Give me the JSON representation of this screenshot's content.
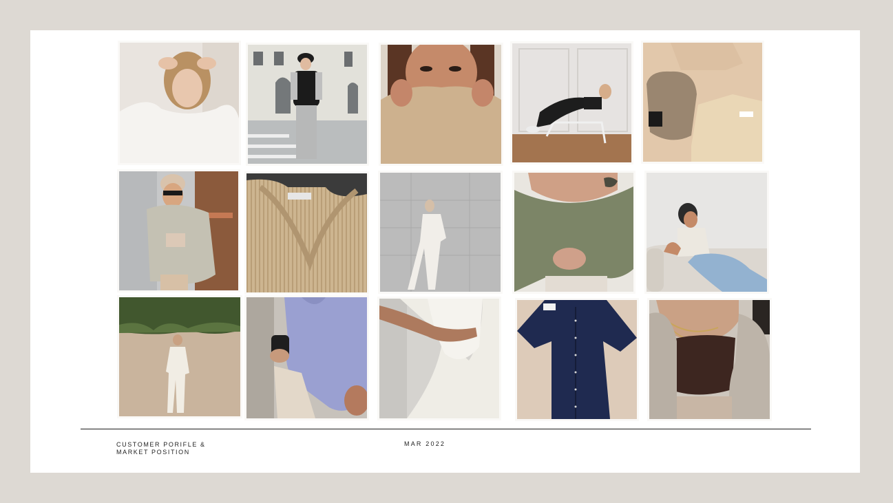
{
  "footer": {
    "title_line_1": "CUSTOMER PORIFLE &",
    "title_line_2": "MARKET POSITION",
    "date": "MAR 2022"
  },
  "palette": {
    "page_bg": "#ddd9d3",
    "slide_bg": "#ffffff",
    "rule": "#1a1a1a"
  },
  "gallery": [
    {
      "id": "woman-white-sweater-hands-in-hair"
    },
    {
      "id": "street-style-puffer-vest"
    },
    {
      "id": "freckled-face-turtleneck"
    },
    {
      "id": "woman-reclining-on-chair"
    },
    {
      "id": "beanie-and-tee-flatlay"
    },
    {
      "id": "woman-bomber-jacket-sunglasses"
    },
    {
      "id": "beige-knit-sweater-closeup"
    },
    {
      "id": "white-suit-concrete-wall"
    },
    {
      "id": "olive-off-shoulder-knit"
    },
    {
      "id": "woman-tank-top-on-sofa"
    },
    {
      "id": "white-outfit-by-hedge-wall"
    },
    {
      "id": "lavender-hoodie-with-coffee"
    },
    {
      "id": "white-ribbed-dress-detail"
    },
    {
      "id": "navy-knit-polo-flatlay"
    },
    {
      "id": "brown-bandeau-with-necklaces"
    }
  ]
}
